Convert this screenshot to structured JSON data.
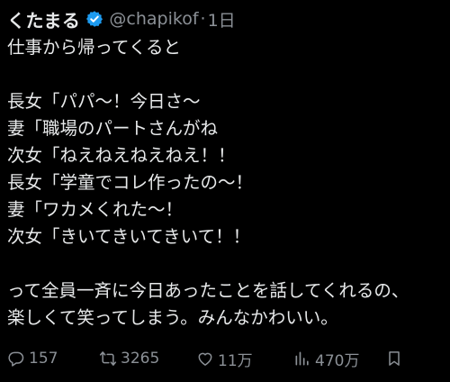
{
  "user": {
    "display_name": "くたまる",
    "handle": "@chapikof",
    "separator": "·",
    "time": "1日"
  },
  "tweet": {
    "lines": [
      "仕事から帰ってくると",
      "",
      "長女「パパ〜！今日さ〜",
      "妻「職場のパートさんがね",
      "次女「ねえねえねえねえ！！",
      "長女「学童でコレ作ったの〜！",
      "妻「ワカメくれた〜！",
      "次女「きいてきいてきいて！！",
      "",
      "って全員一斉に今日あったことを話してくれるの、",
      "楽しくて笑ってしまう。みんなかわいい。"
    ]
  },
  "actions": {
    "reply_count": "157",
    "retweet_count": "3265",
    "like_count": "11万",
    "view_count": "470万"
  },
  "icons": {
    "verified": "verified-badge-icon",
    "reply": "reply-icon",
    "retweet": "retweet-icon",
    "like": "heart-icon",
    "views": "views-chart-icon",
    "bookmark": "bookmark-icon"
  },
  "colors": {
    "background": "#000000",
    "text": "#e7e9ea",
    "secondary": "#8b9096",
    "verified_blue": "#1d9bf0"
  }
}
